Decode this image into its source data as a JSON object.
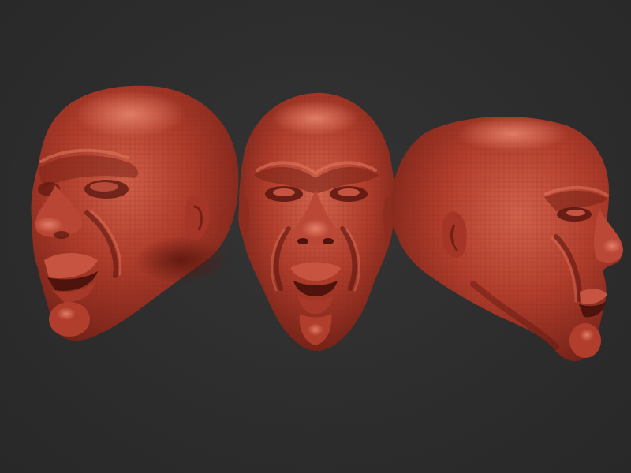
{
  "scene": {
    "background_color": "#2e2e2e",
    "material_color": "#b23b2c",
    "models": [
      {
        "name": "head-three-quarter-left"
      },
      {
        "name": "head-front"
      },
      {
        "name": "head-profile-right"
      }
    ]
  }
}
